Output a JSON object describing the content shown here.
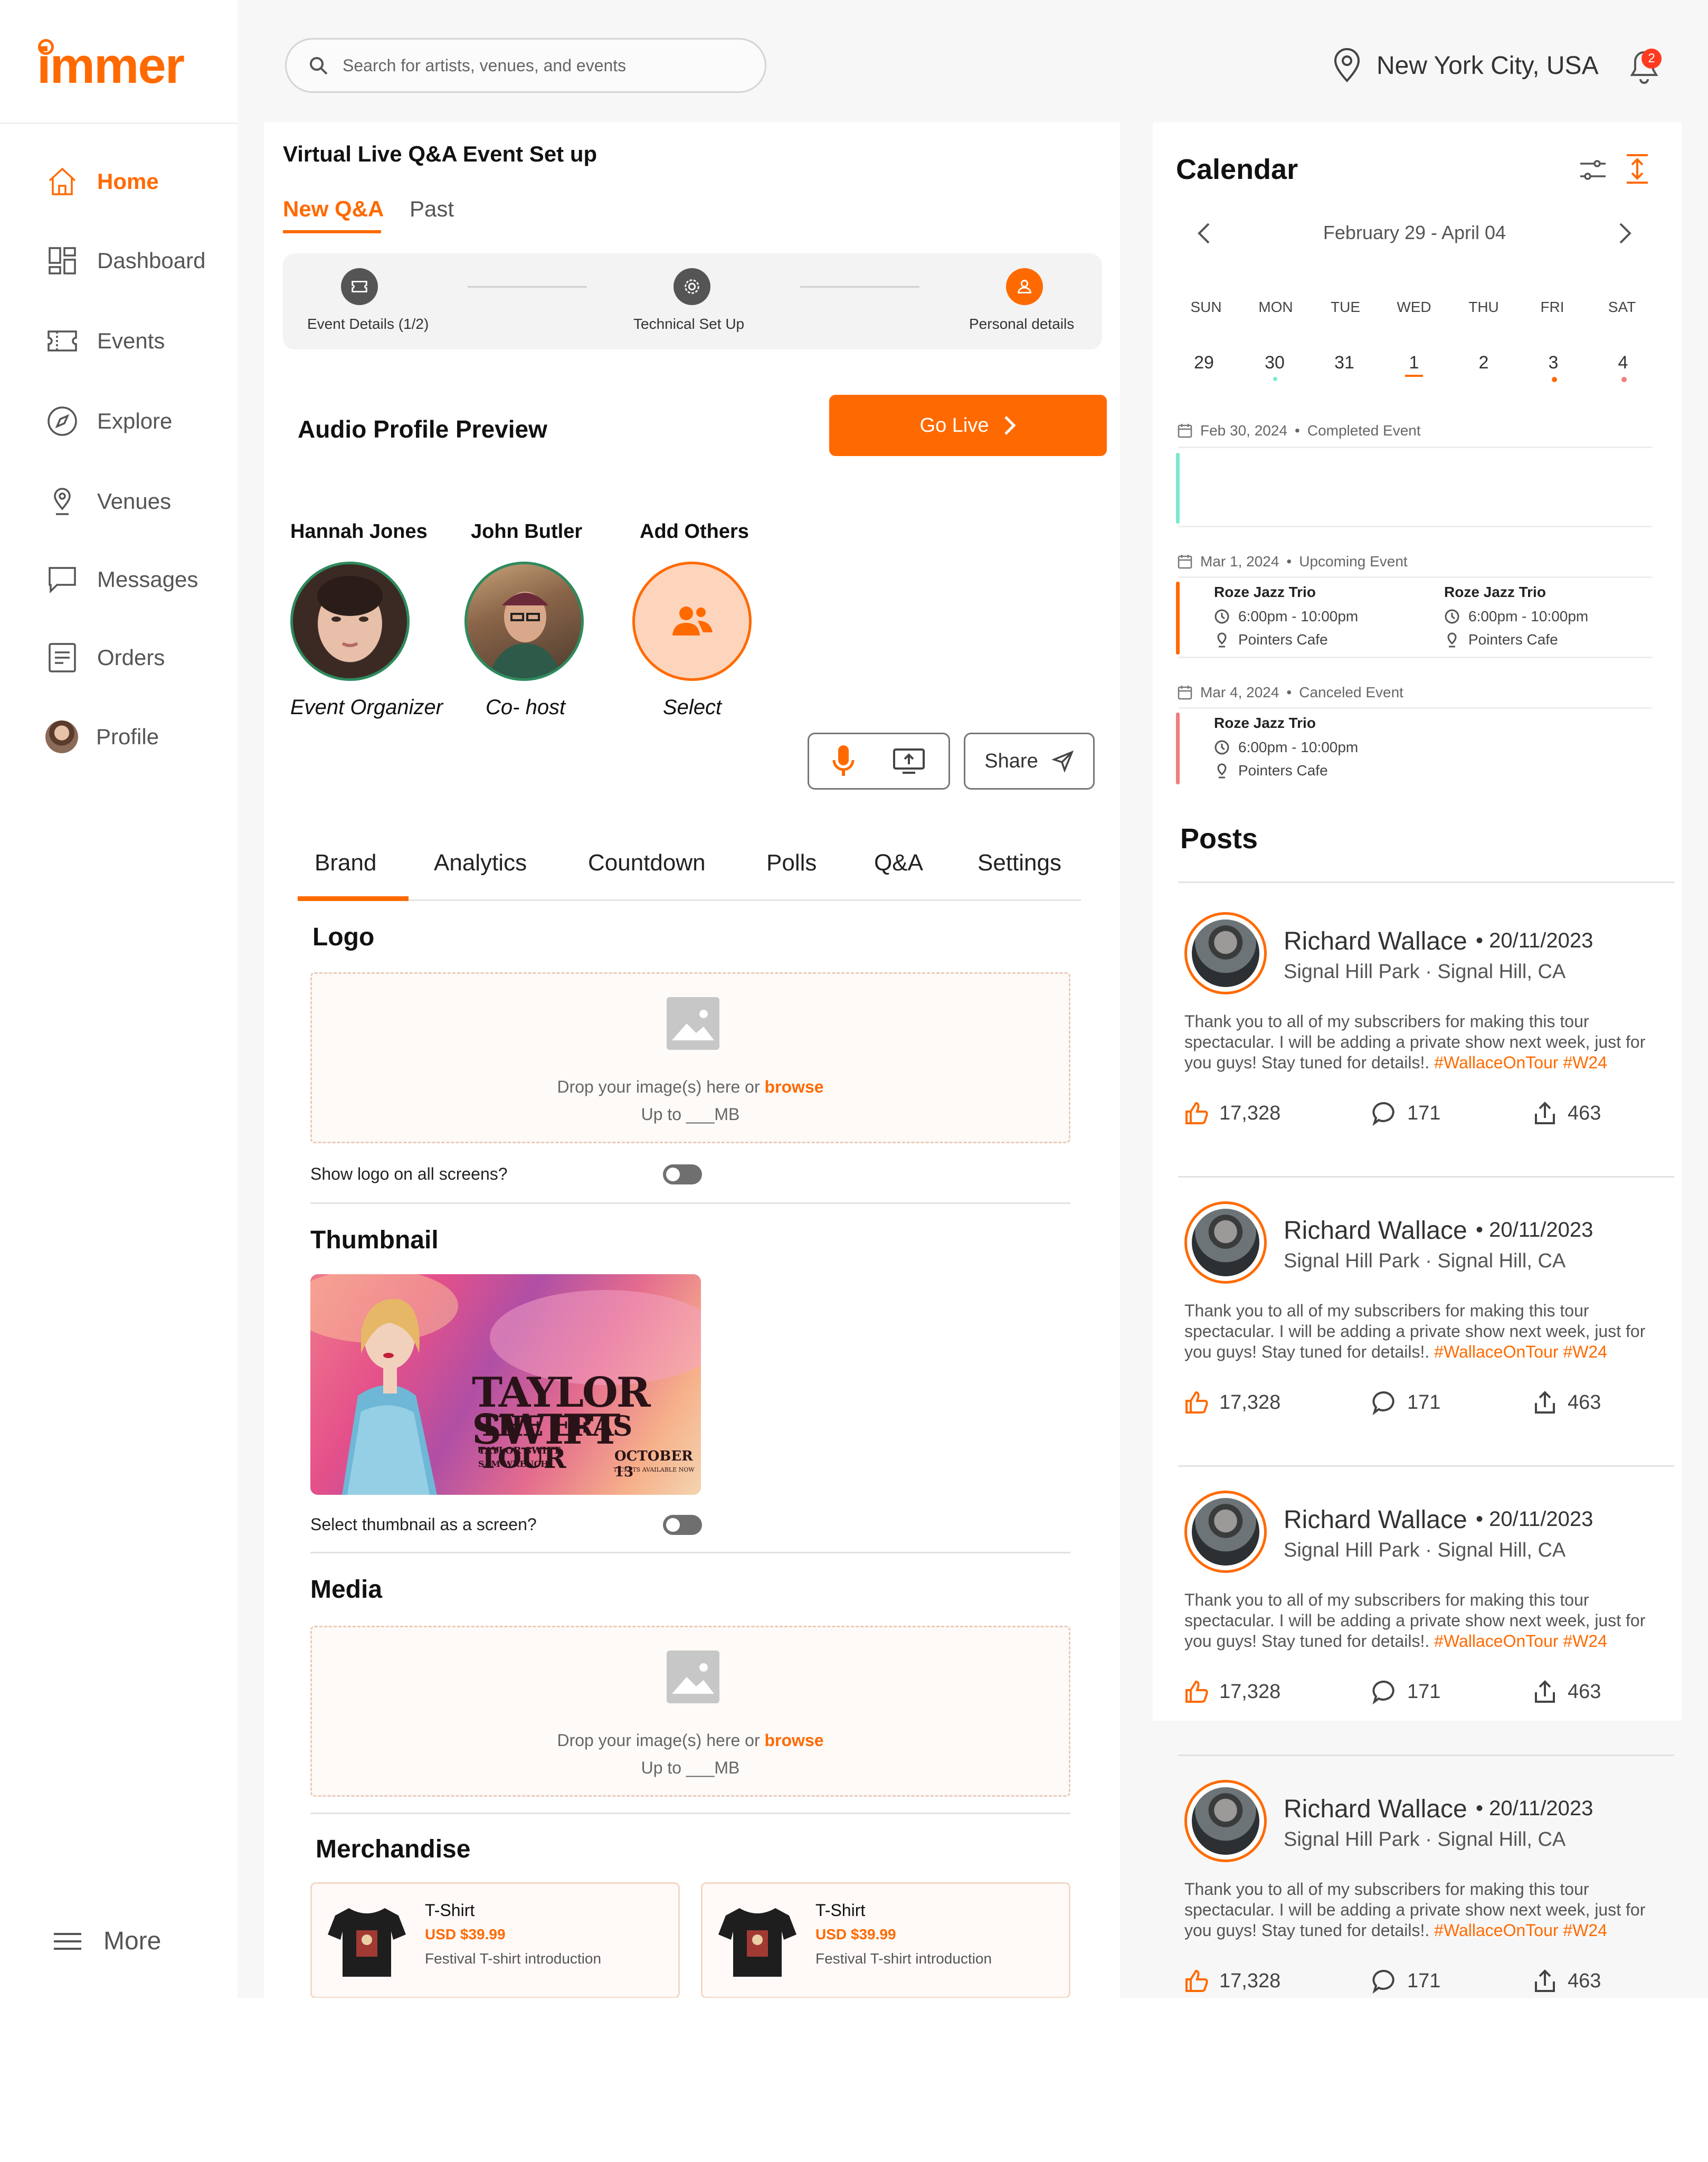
{
  "brand": {
    "logo": "immer"
  },
  "sidebar": {
    "items": [
      {
        "label": "Home",
        "icon": "home-icon"
      },
      {
        "label": "Dashboard",
        "icon": "dashboard-icon"
      },
      {
        "label": "Events",
        "icon": "ticket-icon"
      },
      {
        "label": "Explore",
        "icon": "compass-icon"
      },
      {
        "label": "Venues",
        "icon": "pin-icon"
      },
      {
        "label": "Messages",
        "icon": "message-icon"
      },
      {
        "label": "Orders",
        "icon": "orders-icon"
      },
      {
        "label": "Profile",
        "icon": "avatar"
      }
    ],
    "more": "More"
  },
  "header": {
    "search_placeholder": "Search for artists, venues, and events",
    "location": "New York City, USA",
    "notification_count": "2"
  },
  "setup": {
    "title": "Virtual Live Q&A Event Set up",
    "tabs": [
      "New Q&A",
      "Past"
    ],
    "steps": [
      "Event Details (1/2)",
      "Technical Set Up",
      "Personal details"
    ]
  },
  "audio": {
    "title": "Audio Profile Preview",
    "go_live": "Go Live",
    "people": [
      {
        "name": "Hannah Jones",
        "role": "Event Organizer"
      },
      {
        "name": "John Butler",
        "role": "Co- host"
      },
      {
        "name": "Add Others",
        "role": "Select"
      }
    ],
    "share": "Share"
  },
  "brand_tabs": [
    "Brand",
    "Analytics",
    "Countdown",
    "Polls",
    "Q&A",
    "Settings"
  ],
  "logo_section": {
    "title": "Logo",
    "drop_text": "Drop your image(s) here or",
    "browse": "browse",
    "limit": "Up to ___MB",
    "toggle_label": "Show logo on all screens?"
  },
  "thumbnail_section": {
    "title": "Thumbnail",
    "poster": {
      "line1": "TAYLOR SWIFT",
      "line2": "THE ERAS TOUR",
      "left_small": "TAYLOR SWIFT",
      "left_small2": "SAM WRENCH",
      "date": "OCTOBER 13",
      "tickets": "TICKETS AVAILABLE NOW"
    },
    "toggle_label": "Select thumbnail as a screen?"
  },
  "media_section": {
    "title": "Media",
    "drop_text": "Drop your image(s) here or",
    "browse": "browse",
    "limit": "Up to ___MB"
  },
  "merch_section": {
    "title": "Merchandise",
    "items": [
      {
        "name": "T-Shirt",
        "price": "USD $39.99",
        "desc": "Festival T-shirt introduction"
      },
      {
        "name": "T-Shirt",
        "price": "USD $39.99",
        "desc": "Festival T-shirt introduction"
      }
    ]
  },
  "calendar": {
    "title": "Calendar",
    "range": "February 29 - April 04",
    "days": [
      "SUN",
      "MON",
      "TUE",
      "WED",
      "THU",
      "FRI",
      "SAT"
    ],
    "dates": [
      "29",
      "30",
      "31",
      "1",
      "2",
      "3",
      "4"
    ],
    "events": [
      {
        "date": "Feb 30, 2024",
        "status": "Completed Event",
        "items": []
      },
      {
        "date": "Mar 1, 2024",
        "status": "Upcoming Event",
        "items": [
          {
            "name": "Roze Jazz Trio",
            "time": "6:00pm - 10:00pm",
            "venue": "Pointers Cafe"
          },
          {
            "name": "Roze Jazz Trio",
            "time": "6:00pm - 10:00pm",
            "venue": "Pointers Cafe"
          }
        ]
      },
      {
        "date": "Mar 4, 2024",
        "status": "Canceled Event",
        "items": [
          {
            "name": "Roze Jazz Trio",
            "time": "6:00pm - 10:00pm",
            "venue": "Pointers Cafe"
          }
        ]
      }
    ],
    "colors": {
      "completed": "#7ee8d0",
      "upcoming": "#ff6a00",
      "canceled": "#f07d7d"
    }
  },
  "posts": {
    "title": "Posts",
    "items": [
      {
        "author": "Richard Wallace",
        "date": "20/11/2023",
        "location": "Signal Hill Park · Signal Hill, CA",
        "body": "Thank you to all of my subscribers for making this tour spectacular. I will be adding a private show next week, just for you guys! Stay tuned for details!.",
        "tags": "#WallaceOnTour #W24",
        "likes": "17,328",
        "comments": "171",
        "shares": "463"
      },
      {
        "author": "Richard Wallace",
        "date": "20/11/2023",
        "location": "Signal Hill Park · Signal Hill, CA",
        "body": "Thank you to all of my subscribers for making this tour spectacular. I will be adding a private show next week, just for you guys! Stay tuned for details!.",
        "tags": "#WallaceOnTour #W24",
        "likes": "17,328",
        "comments": "171",
        "shares": "463"
      },
      {
        "author": "Richard Wallace",
        "date": "20/11/2023",
        "location": "Signal Hill Park · Signal Hill, CA",
        "body": "Thank you to all of my subscribers for making this tour spectacular. I will be adding a private show next week, just for you guys! Stay tuned for details!.",
        "tags": "#WallaceOnTour #W24",
        "likes": "17,328",
        "comments": "171",
        "shares": "463"
      },
      {
        "author": "Richard Wallace",
        "date": "20/11/2023",
        "location": "Signal Hill Park · Signal Hill, CA",
        "body": "Thank you to all of my subscribers for making this tour spectacular. I will be adding a private show next week, just for you guys! Stay tuned for details!.",
        "tags": "#WallaceOnTour #W24",
        "likes": "17,328",
        "comments": "171",
        "shares": "463"
      }
    ]
  },
  "theme": {
    "accent": "#ff6a00"
  }
}
